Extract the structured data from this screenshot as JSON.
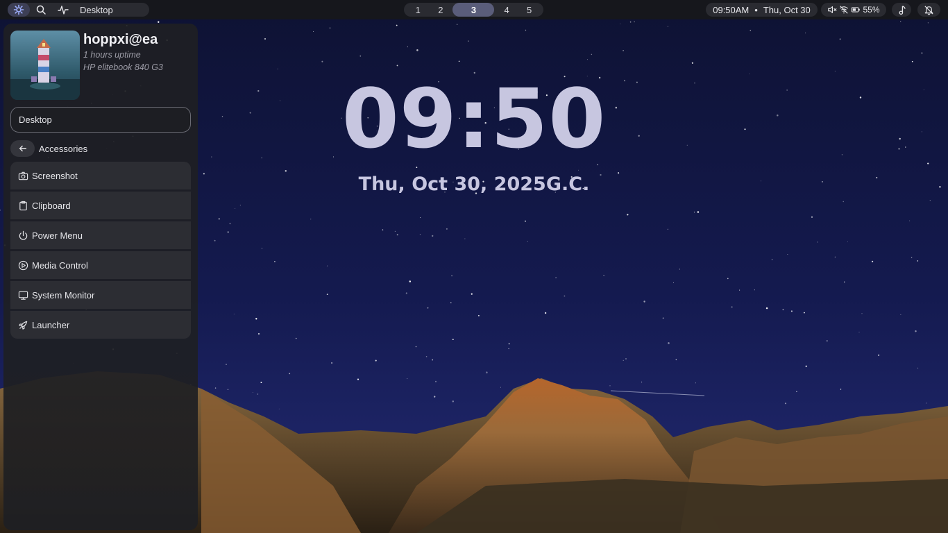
{
  "topbar": {
    "launcher_icon": "gear-flower-icon",
    "search_icon": "search-icon",
    "activity_icon": "activity-icon",
    "active_window": "Desktop",
    "workspaces": [
      "1",
      "2",
      "3",
      "4",
      "5"
    ],
    "active_workspace": "3",
    "time": "09:50AM",
    "separator": "•",
    "date": "Thu, Oct 30",
    "status_icons": [
      "volume-muted-icon",
      "wifi-off-icon",
      "battery-icon"
    ],
    "battery": "55%",
    "music_icon": "music-note-icon",
    "notifications_icon": "bell-off-icon"
  },
  "desktop": {
    "clock": "09:50",
    "date": "Thu, Oct 30, 2025G.C."
  },
  "panel": {
    "username": "hoppxi@ea",
    "uptime": "1 hours uptime",
    "machine": "HP elitebook 840 G3",
    "search_value": "Desktop",
    "category": "Accessories",
    "items": [
      {
        "label": "Screenshot",
        "icon": "camera-icon"
      },
      {
        "label": "Clipboard",
        "icon": "clipboard-icon"
      },
      {
        "label": "Power Menu",
        "icon": "power-icon"
      },
      {
        "label": "Media Control",
        "icon": "play-circle-icon"
      },
      {
        "label": "System Monitor",
        "icon": "monitor-icon"
      },
      {
        "label": "Launcher",
        "icon": "rocket-icon"
      }
    ]
  },
  "colors": {
    "accent": "#5a5d7a",
    "clock_text": "#c7c6e0",
    "bar_bg": "#16171c",
    "panel_bg": "#1e1f24"
  }
}
